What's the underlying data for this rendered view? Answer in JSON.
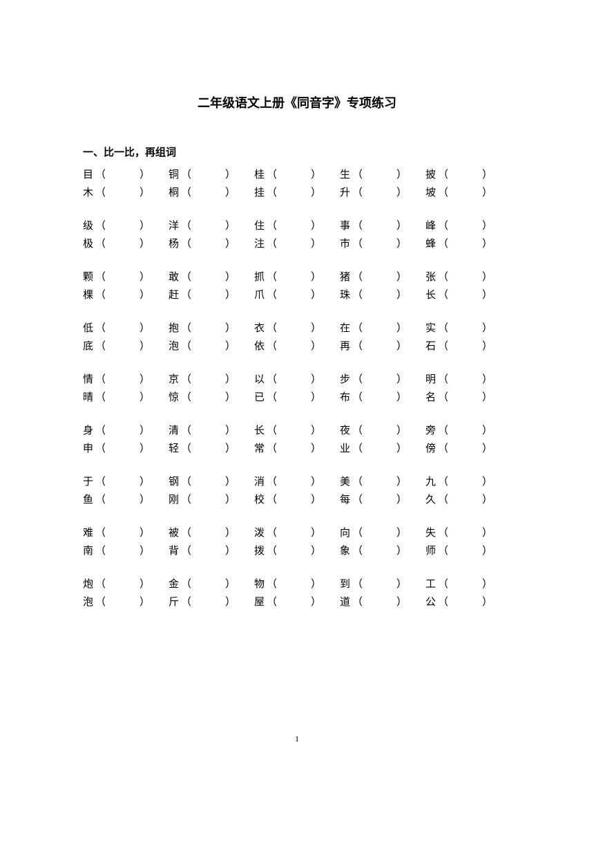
{
  "title": "二年级语文上册《同音字》专项练习",
  "section_header": "一、比一比，再组词",
  "page_number": "1",
  "groups": [
    {
      "row1": [
        "目",
        "铜",
        "桂",
        "生",
        "披"
      ],
      "row2": [
        "木",
        "桐",
        "挂",
        "升",
        "坡"
      ]
    },
    {
      "row1": [
        "级",
        "洋",
        "住",
        "事",
        "峰"
      ],
      "row2": [
        "极",
        "杨",
        "注",
        "市",
        "蜂"
      ]
    },
    {
      "row1": [
        "颗",
        "敢",
        "抓",
        "猪",
        "张"
      ],
      "row2": [
        "棵",
        "赶",
        "爪",
        "珠",
        "长"
      ]
    },
    {
      "row1": [
        "低",
        "抱",
        "衣",
        "在",
        "实"
      ],
      "row2": [
        "底",
        "泡",
        "依",
        "再",
        "石"
      ]
    },
    {
      "row1": [
        "情",
        "京",
        "以",
        "步",
        "明"
      ],
      "row2": [
        "晴",
        "惊",
        "已",
        "布",
        "名"
      ]
    },
    {
      "row1": [
        "身",
        "清",
        "长",
        "夜",
        "旁"
      ],
      "row2": [
        "申",
        "轻",
        "常",
        "业",
        "傍"
      ]
    },
    {
      "row1": [
        "于",
        "钢",
        "消",
        "美",
        "九"
      ],
      "row2": [
        "鱼",
        "刚",
        "校",
        "每",
        "久"
      ]
    },
    {
      "row1": [
        "难",
        "被",
        "泼",
        "向",
        "失"
      ],
      "row2": [
        "南",
        "背",
        "拨",
        "象",
        "师"
      ]
    },
    {
      "row1": [
        "炮",
        "金",
        "物",
        "到",
        "工"
      ],
      "row2": [
        "泡",
        "斤",
        "屋",
        "道",
        "公"
      ]
    }
  ]
}
